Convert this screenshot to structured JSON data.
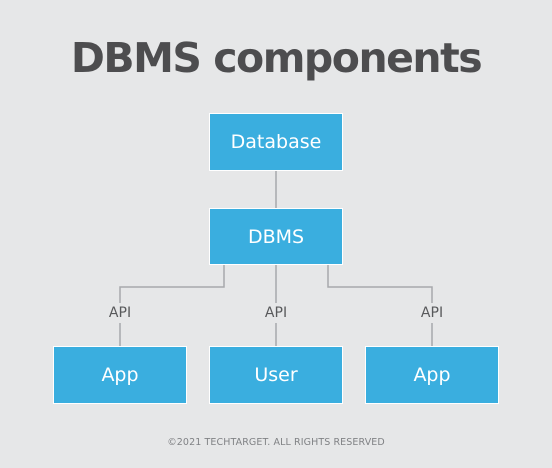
{
  "title": "DBMS components",
  "nodes": {
    "database": "Database",
    "dbms": "DBMS",
    "app_left": "App",
    "user": "User",
    "app_right": "App"
  },
  "edge_labels": {
    "left": "API",
    "center": "API",
    "right": "API"
  },
  "footer": "©2021 TECHTARGET. ALL RIGHTS RESERVED",
  "colors": {
    "background": "#e6e7e8",
    "box": "#3aaedf",
    "box_text": "#ffffff",
    "connector": "#a7a9ac",
    "title": "#4d4d4f"
  }
}
